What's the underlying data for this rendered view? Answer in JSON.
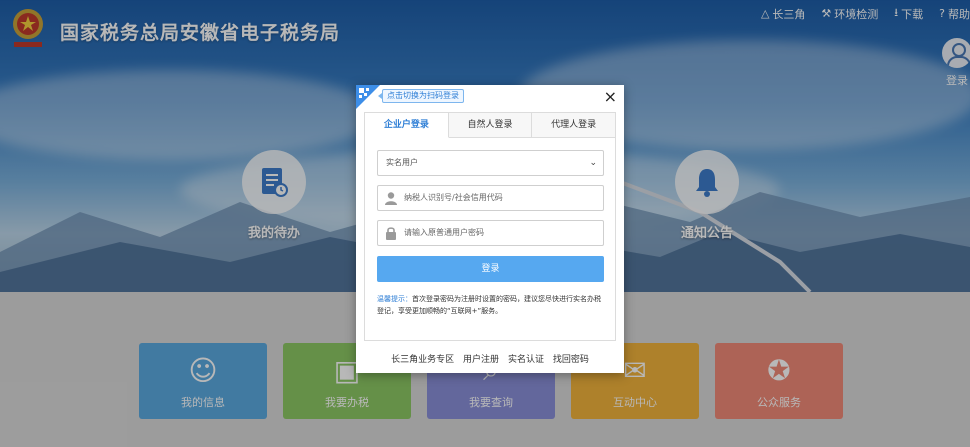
{
  "site": {
    "title": "国家税务总局安徽省电子税务局"
  },
  "topnav": [
    {
      "icon": "triangle-icon",
      "glyph": "△",
      "label": "长三角"
    },
    {
      "icon": "wrench-icon",
      "glyph": "⚒",
      "label": "环境检测"
    },
    {
      "icon": "download-icon",
      "glyph": "⭳",
      "label": "下载"
    },
    {
      "icon": "help-icon",
      "glyph": "?",
      "label": "帮助"
    }
  ],
  "user": {
    "login_label": "登录"
  },
  "features": {
    "todo_label": "我的待办",
    "notice_label": "通知公告"
  },
  "tiles": [
    {
      "label": "我的信息",
      "glyph": "☺",
      "color": "#5aa9e0"
    },
    {
      "label": "我要办税",
      "glyph": "▣",
      "color": "#8cc864"
    },
    {
      "label": "我要查询",
      "glyph": "⌕",
      "color": "#8a8fd8"
    },
    {
      "label": "互动中心",
      "glyph": "✉",
      "color": "#f2b33c"
    },
    {
      "label": "公众服务",
      "glyph": "✪",
      "color": "#f08a78"
    }
  ],
  "modal": {
    "qr_hint": "点击切换为扫码登录",
    "close": "×",
    "tabs": [
      {
        "label": "企业户登录",
        "active": true
      },
      {
        "label": "自然人登录",
        "active": false
      },
      {
        "label": "代理人登录",
        "active": false
      }
    ],
    "user_type_value": "实名用户",
    "taxpayer_placeholder": "纳税人识别号/社会信用代码",
    "password_placeholder": "请输入原普通用户密码",
    "login_button": "登录",
    "tip_key": "温馨提示：",
    "tip_text": "首次登录密码为注册时设置的密码，建议您尽快进行实名办税登记，享受更加顺畅的“互联网+”服务。",
    "links": [
      "长三角业务专区",
      "用户注册",
      "实名认证",
      "找回密码"
    ]
  },
  "colors": {
    "accent": "#2f7fd6",
    "button": "#56a8f0"
  }
}
